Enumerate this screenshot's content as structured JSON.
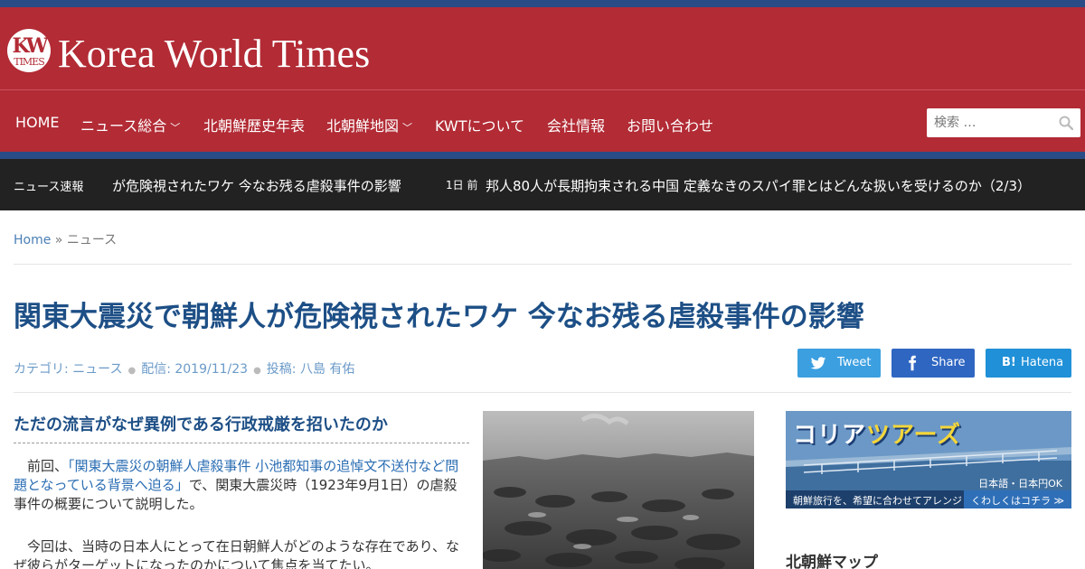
{
  "site": {
    "logo_kw": "KW",
    "logo_times": "TIMES",
    "name": "Korea World Times"
  },
  "nav": {
    "items": [
      {
        "label": "HOME",
        "dropdown": false
      },
      {
        "label": "ニュース総合",
        "dropdown": true
      },
      {
        "label": "北朝鮮歴史年表",
        "dropdown": false
      },
      {
        "label": "北朝鮮地図",
        "dropdown": true
      },
      {
        "label": "KWTについて",
        "dropdown": false
      },
      {
        "label": "会社情報",
        "dropdown": false
      },
      {
        "label": "お問い合わせ",
        "dropdown": false
      }
    ],
    "search_placeholder": "検索 …"
  },
  "ticker": {
    "label": "ニュース速報",
    "item1": "が危険視されたワケ 今なお残る虐殺事件の影響",
    "item2_time": "1日 前",
    "item2": "邦人80人が長期拘束される中国 定義なきのスパイ罪とはどんな扱いを受けるのか（2/3）"
  },
  "breadcrumb": {
    "home": "Home",
    "sep": "»",
    "current": "ニュース"
  },
  "article": {
    "title": "関東大震災で朝鮮人が危険視されたワケ 今なお残る虐殺事件の影響",
    "meta": {
      "category": "カテゴリ: ニュース",
      "date": "配信: 2019/11/23",
      "author": "投稿: 八島 有佑"
    },
    "subheading": "ただの流言がなぜ異例である行政戒厳を招いたのか",
    "para1_prefix": "　前回、",
    "para1_link": "「関東大震災の朝鮮人虐殺事件 小池都知事の追悼文不送付など問題となっている背景へ迫る」",
    "para1_suffix": "で、関東大震災時（1923年9月1日）の虐殺事件の概要について説明した。",
    "para2": "　今回は、当時の日本人にとって在日朝鮮人がどのような存在であり、なぜ彼らがターゲットになったのかについて焦点を当てたい。"
  },
  "share": {
    "twitter": "Tweet",
    "facebook": "Share",
    "hatena": "Hatena"
  },
  "sidebar": {
    "ad": {
      "title_part1": "コリア",
      "title_part2": "ツアーズ",
      "jpy": "日本語・日本円OK",
      "strip_left": "朝鮮旅行を、希望に合わせてアレンジ",
      "strip_right": "くわしくはコチラ ≫"
    },
    "widget_title": "北朝鮮マップ"
  },
  "colors": {
    "brand_red": "#b22b35",
    "brand_blue": "#2a4c86",
    "title_blue": "#1d4f86"
  }
}
